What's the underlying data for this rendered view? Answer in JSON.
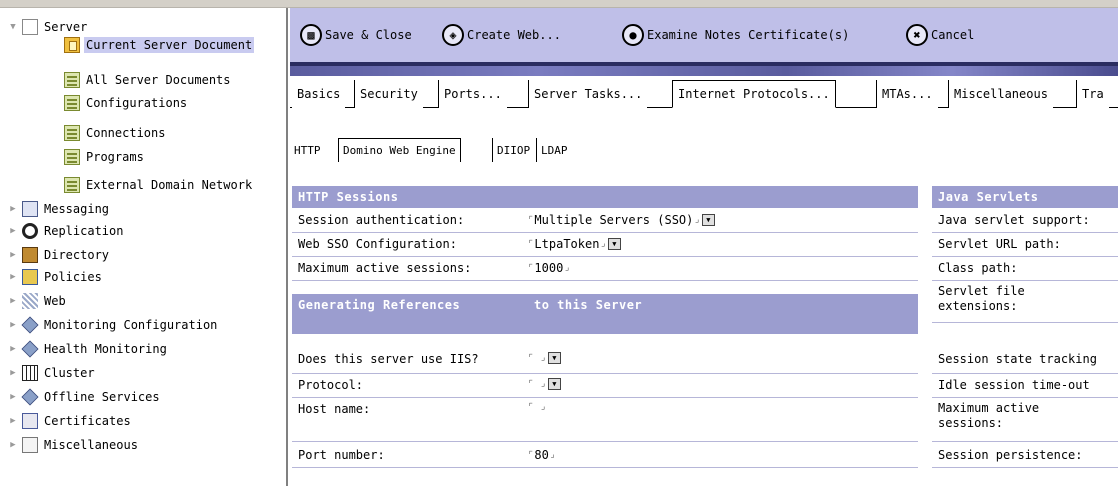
{
  "nav": {
    "items": [
      {
        "label": "Server",
        "icon": "document-icon",
        "expanded": true
      },
      {
        "label": "Current Server Document",
        "icon": "current-document-icon",
        "selected": true
      },
      {
        "label": "All Server Documents",
        "icon": "view-icon"
      },
      {
        "label": "Configurations",
        "icon": "view-icon"
      },
      {
        "label": "Connections",
        "icon": "view-icon"
      },
      {
        "label": "Programs",
        "icon": "view-icon"
      },
      {
        "label": "External Domain Network",
        "icon": "view-icon"
      },
      {
        "label": "Messaging",
        "icon": "messaging-icon"
      },
      {
        "label": "Replication",
        "icon": "replication-icon"
      },
      {
        "label": "Directory",
        "icon": "directory-icon"
      },
      {
        "label": "Policies",
        "icon": "policies-icon"
      },
      {
        "label": "Web",
        "icon": "web-icon"
      },
      {
        "label": "Monitoring Configuration",
        "icon": "monitoring-icon"
      },
      {
        "label": "Health Monitoring",
        "icon": "health-icon"
      },
      {
        "label": "Cluster",
        "icon": "cluster-icon"
      },
      {
        "label": "Offline Services",
        "icon": "offline-icon"
      },
      {
        "label": "Certificates",
        "icon": "certificates-icon"
      },
      {
        "label": "Miscellaneous",
        "icon": "folder-icon"
      }
    ]
  },
  "actions": {
    "save_close": "Save & Close",
    "create_web": "Create Web...",
    "examine_notes": "Examine Notes Certificate(s)",
    "cancel": "Cancel"
  },
  "tabs1": [
    "Basics",
    "Security",
    "Ports...",
    "Server Tasks...",
    "Internet Protocols...",
    "MTAs...",
    "Miscellaneous",
    "Tra"
  ],
  "tabs2": [
    "HTTP",
    "Domino Web Engine",
    "DIIOP",
    "LDAP"
  ],
  "http_sessions": {
    "header": "HTTP Sessions",
    "session_auth_label": "Session authentication:",
    "session_auth_value": "Multiple Servers (SSO)",
    "web_sso_label": "Web SSO Configuration:",
    "web_sso_value": "LtpaToken",
    "max_sessions_label": "Maximum active sessions:",
    "max_sessions_value": "1000"
  },
  "generating": {
    "header_a": "Generating References",
    "header_b": "to this Server",
    "iis_label": "Does this server use IIS?",
    "protocol_label": "Protocol:",
    "host_label": "Host name:",
    "port_label": "Port number:",
    "port_value": "80"
  },
  "java_servlets": {
    "header": "Java Servlets",
    "support_label": "Java servlet support:",
    "url_path_label": "Servlet URL path:",
    "class_path_label": "Class path:",
    "file_ext_label": "Servlet file extensions:",
    "state_tracking_label": "Session state tracking",
    "idle_timeout_label": "Idle session time-out",
    "max_active_label": "Maximum active sessions:",
    "persistence_label": "Session persistence:"
  },
  "colors": {
    "action_bar": "#bfbfe8",
    "section_header": "#9b9dcf",
    "selection": "#c9cbf0"
  }
}
